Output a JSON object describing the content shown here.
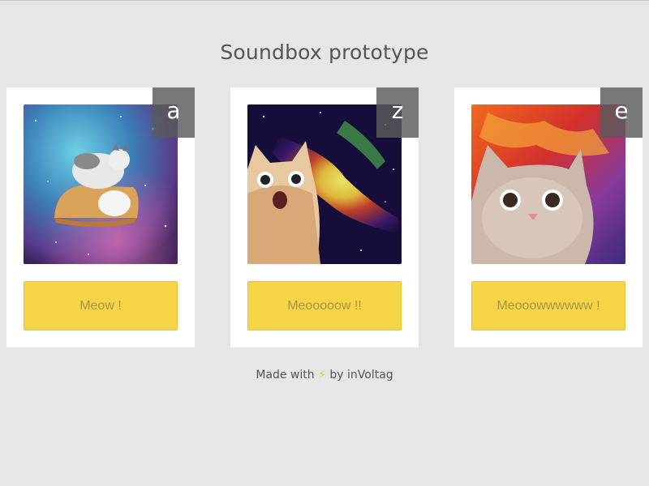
{
  "page": {
    "title": "Soundbox prototype"
  },
  "cards": [
    {
      "key": "a",
      "button_label": "Meow !",
      "image": "cat-on-pastry-in-space"
    },
    {
      "key": "z",
      "button_label": "Meooooow !!",
      "image": "surprised-cat-in-nebula"
    },
    {
      "key": "e",
      "button_label": "Meooowwwwww !",
      "image": "chubby-cat-fire-nebula"
    }
  ],
  "footer": {
    "prefix": "Made with",
    "icon": "lightning-icon",
    "glyph": "⚡",
    "suffix": "by inVoltag"
  },
  "colors": {
    "background": "#e6e6e6",
    "card": "#ffffff",
    "button": "#f5d547",
    "button_text": "#a89445",
    "badge": "#5a5a5a"
  }
}
